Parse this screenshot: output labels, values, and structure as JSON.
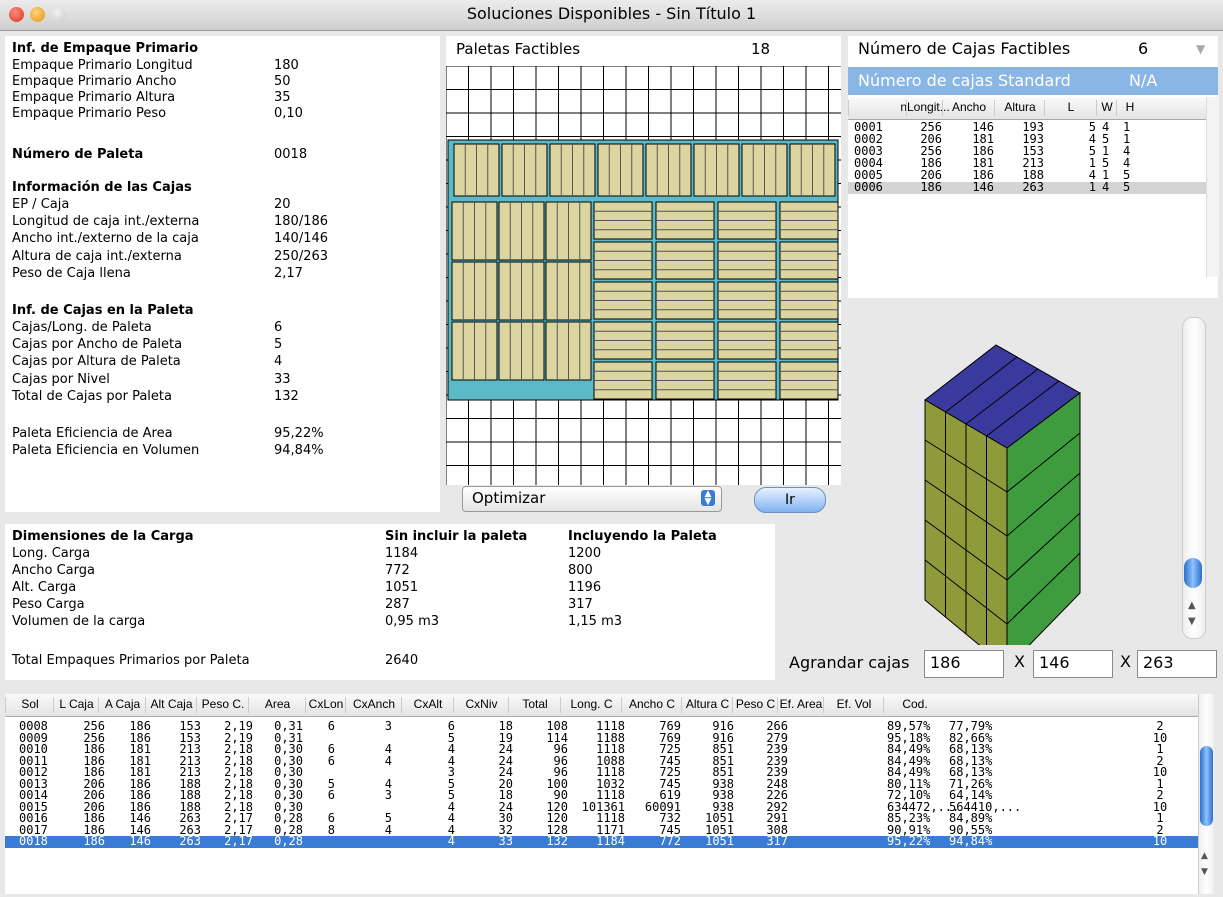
{
  "window": {
    "title": "Soluciones Disponibles - Sin Título 1"
  },
  "primary": {
    "heading": "Inf. de Empaque Primario",
    "rows": [
      [
        "Empaque Primario Longitud",
        "180"
      ],
      [
        "Empaque Primario Ancho",
        "50"
      ],
      [
        "Empaque Primario Altura",
        "35"
      ],
      [
        "Empaque Primario Peso",
        "0,10"
      ]
    ]
  },
  "pallet_no": {
    "label": "Número de Paleta",
    "value": "0018"
  },
  "boxes_info": {
    "heading": "Información de las Cajas",
    "rows": [
      [
        "EP / Caja",
        "20"
      ],
      [
        "Longitud de caja int./externa",
        "180/186"
      ],
      [
        "Ancho int./externo de la caja",
        "140/146"
      ],
      [
        "Altura de caja int./externa",
        "250/263"
      ],
      [
        "Peso de Caja llena",
        "2,17"
      ]
    ]
  },
  "pallet_boxes": {
    "heading": "Inf. de Cajas en la Paleta",
    "rows": [
      [
        "Cajas/Long. de Paleta",
        "6"
      ],
      [
        "Cajas por Ancho de Paleta",
        "5"
      ],
      [
        "Cajas por Altura de Paleta",
        "4"
      ],
      [
        "Cajas por Nivel",
        "33"
      ],
      [
        "Total de Cajas por Paleta",
        "132"
      ]
    ]
  },
  "efficiency": {
    "rows": [
      [
        "Paleta Eficiencia de Area",
        "95,22%"
      ],
      [
        "Paleta Eficiencia en Volumen",
        "94,84%"
      ]
    ]
  },
  "feasible": {
    "label": "Paletas Factibles",
    "value": "18"
  },
  "optimize": {
    "select": "Optimizar",
    "go": "Ir"
  },
  "boxes_count": {
    "label": "Número de Cajas Factibles",
    "value": "6",
    "standard_label": "Número de cajas Standard",
    "standard_value": "N/A"
  },
  "box_table": {
    "headers": [
      "n",
      "Longit...",
      "Ancho",
      "Altura",
      "L",
      "W",
      "H"
    ],
    "rows": [
      [
        "0001",
        "256",
        "146",
        "193",
        "5",
        "4",
        "1"
      ],
      [
        "0002",
        "206",
        "181",
        "193",
        "4",
        "5",
        "1"
      ],
      [
        "0003",
        "256",
        "186",
        "153",
        "5",
        "1",
        "4"
      ],
      [
        "0004",
        "186",
        "181",
        "213",
        "1",
        "5",
        "4"
      ],
      [
        "0005",
        "206",
        "186",
        "188",
        "4",
        "1",
        "5"
      ],
      [
        "0006",
        "186",
        "146",
        "263",
        "1",
        "4",
        "5"
      ]
    ]
  },
  "load": {
    "heading": "Dimensiones de la Carga",
    "col1": "Sin incluir la paleta",
    "col2": "Incluyendo la Paleta",
    "rows": [
      [
        "Long. Carga",
        "1184",
        "1200"
      ],
      [
        "Ancho Carga",
        "772",
        "800"
      ],
      [
        "Alt. Carga",
        "1051",
        "1196"
      ],
      [
        "Peso Carga",
        "287",
        "317"
      ],
      [
        "Volumen de la carga",
        "0,95 m3",
        "1,15 m3"
      ]
    ],
    "total_label": "Total Empaques Primarios por Paleta",
    "total_value": "2640"
  },
  "enlarge": {
    "label": "Agrandar cajas",
    "x1": "186",
    "sep1": "X",
    "x2": "146",
    "sep2": "X",
    "x3": "263"
  },
  "solutions": {
    "headers": [
      "Sol",
      "L Caja",
      "A Caja",
      "Alt Caja",
      "Peso C.",
      "Area",
      "CxLon",
      "CxAnch",
      "CxAlt",
      "CxNiv",
      "Total",
      "Long. C",
      "Ancho C",
      "Altura C",
      "Peso C",
      "Ef. Area",
      "Ef. Vol",
      "Cod."
    ],
    "rows": [
      [
        "0008",
        "256",
        "186",
        "153",
        "2,19",
        "0,31",
        "6",
        "3",
        "6",
        "18",
        "108",
        "1118",
        "769",
        "916",
        "266",
        "89,57%",
        "77,79%",
        "2"
      ],
      [
        "0009",
        "256",
        "186",
        "153",
        "2,19",
        "0,31",
        "",
        "",
        "5",
        "19",
        "114",
        "1188",
        "769",
        "916",
        "279",
        "95,18%",
        "82,66%",
        "10"
      ],
      [
        "0010",
        "186",
        "181",
        "213",
        "2,18",
        "0,30",
        "6",
        "4",
        "4",
        "24",
        "96",
        "1118",
        "725",
        "851",
        "239",
        "84,49%",
        "68,13%",
        "1"
      ],
      [
        "0011",
        "186",
        "181",
        "213",
        "2,18",
        "0,30",
        "6",
        "4",
        "4",
        "24",
        "96",
        "1088",
        "745",
        "851",
        "239",
        "84,49%",
        "68,13%",
        "2"
      ],
      [
        "0012",
        "186",
        "181",
        "213",
        "2,18",
        "0,30",
        "",
        "",
        "3",
        "24",
        "96",
        "1118",
        "725",
        "851",
        "239",
        "84,49%",
        "68,13%",
        "10"
      ],
      [
        "0013",
        "206",
        "186",
        "188",
        "2,18",
        "0,30",
        "5",
        "4",
        "5",
        "20",
        "100",
        "1032",
        "745",
        "938",
        "248",
        "80,11%",
        "71,26%",
        "1"
      ],
      [
        "0014",
        "206",
        "186",
        "188",
        "2,18",
        "0,30",
        "6",
        "3",
        "5",
        "18",
        "90",
        "1118",
        "619",
        "938",
        "226",
        "72,10%",
        "64,14%",
        "2"
      ],
      [
        "0015",
        "206",
        "186",
        "188",
        "2,18",
        "0,30",
        "",
        "",
        "4",
        "24",
        "120",
        "101361",
        "60091",
        "938",
        "292",
        "634472,...",
        "564410,...",
        "10"
      ],
      [
        "0016",
        "186",
        "146",
        "263",
        "2,17",
        "0,28",
        "6",
        "5",
        "4",
        "30",
        "120",
        "1118",
        "732",
        "1051",
        "291",
        "85,23%",
        "84,89%",
        "1"
      ],
      [
        "0017",
        "186",
        "146",
        "263",
        "2,17",
        "0,28",
        "8",
        "4",
        "4",
        "32",
        "128",
        "1171",
        "745",
        "1051",
        "308",
        "90,91%",
        "90,55%",
        "2"
      ],
      [
        "0018",
        "186",
        "146",
        "263",
        "2,17",
        "0,28",
        "",
        "",
        "4",
        "33",
        "132",
        "1184",
        "772",
        "1051",
        "317",
        "95,22%",
        "94,84%",
        "10"
      ]
    ]
  },
  "colors": {
    "selection": "#3a7bd5",
    "header_blue": "#8ab6e6",
    "box_fill": "#ddd5a0",
    "pallet": "#5bbac8",
    "cube_top": "#3a3a9e",
    "cube_left": "#8f9a3a",
    "cube_right": "#3e9c3e"
  }
}
